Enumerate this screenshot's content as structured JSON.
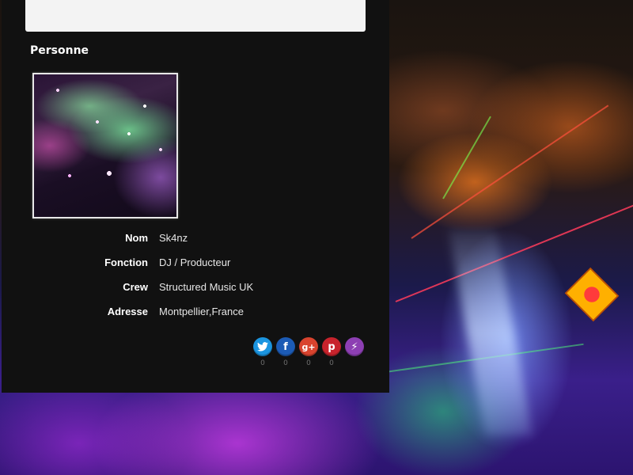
{
  "colors": {
    "panel_bg": "#111111",
    "top_box_bg": "#f3f3f3",
    "twitter": "#1b95e0",
    "facebook": "#1c5bb5",
    "googleplus": "#d9432e",
    "pinterest": "#c8232c",
    "flattr": "#8d3fb3"
  },
  "section": {
    "title": "Personne"
  },
  "person": {
    "fields": [
      {
        "label": "Nom",
        "value": "Sk4nz"
      },
      {
        "label": "Fonction",
        "value": "DJ / Producteur"
      },
      {
        "label": "Crew",
        "value": "Structured Music UK"
      },
      {
        "label": "Adresse",
        "value": "Montpellier,France"
      }
    ]
  },
  "share": {
    "buttons": [
      {
        "icon": "twitter-bird-icon",
        "glyph": "t",
        "count": "0"
      },
      {
        "icon": "facebook-f-icon",
        "glyph": "f",
        "count": "0"
      },
      {
        "icon": "google-plus-icon",
        "glyph": "g+",
        "count": "0"
      },
      {
        "icon": "pinterest-p-icon",
        "glyph": "p",
        "count": "0"
      },
      {
        "icon": "flattr-bolt-icon",
        "glyph": "⚡",
        "count": ""
      }
    ]
  }
}
